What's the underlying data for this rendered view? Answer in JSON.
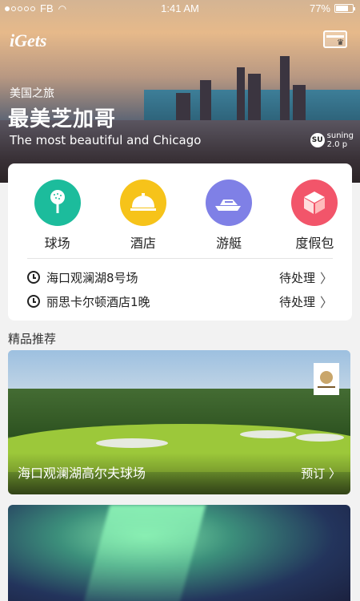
{
  "status_bar": {
    "carrier": "FB",
    "time": "1:41 AM",
    "battery": "77%"
  },
  "header": {
    "logo": "iGets",
    "card_icon": "membership-card-icon"
  },
  "hero": {
    "subtitle": "美国之旅",
    "title": "最美芝加哥",
    "english": "The most beautiful and Chicago",
    "badge_text": "suning",
    "badge_version": "2.0 p"
  },
  "services": [
    {
      "label": "球场",
      "icon": "golf-icon",
      "color": "#1cbc9c"
    },
    {
      "label": "酒店",
      "icon": "hotel-bell-icon",
      "color": "#f6c31a"
    },
    {
      "label": "游艇",
      "icon": "yacht-icon",
      "color": "#7f80e6"
    },
    {
      "label": "度假包",
      "icon": "package-icon",
      "color": "#f2556a"
    }
  ],
  "tasks": [
    {
      "name": "海口观澜湖8号场",
      "status": "待处理"
    },
    {
      "name": "丽思卡尔顿酒店1晚",
      "status": "待处理"
    }
  ],
  "section": {
    "title": "精品推荐"
  },
  "recommendations": [
    {
      "title": "海口观澜湖高尔夫球场",
      "action": "预订"
    }
  ]
}
